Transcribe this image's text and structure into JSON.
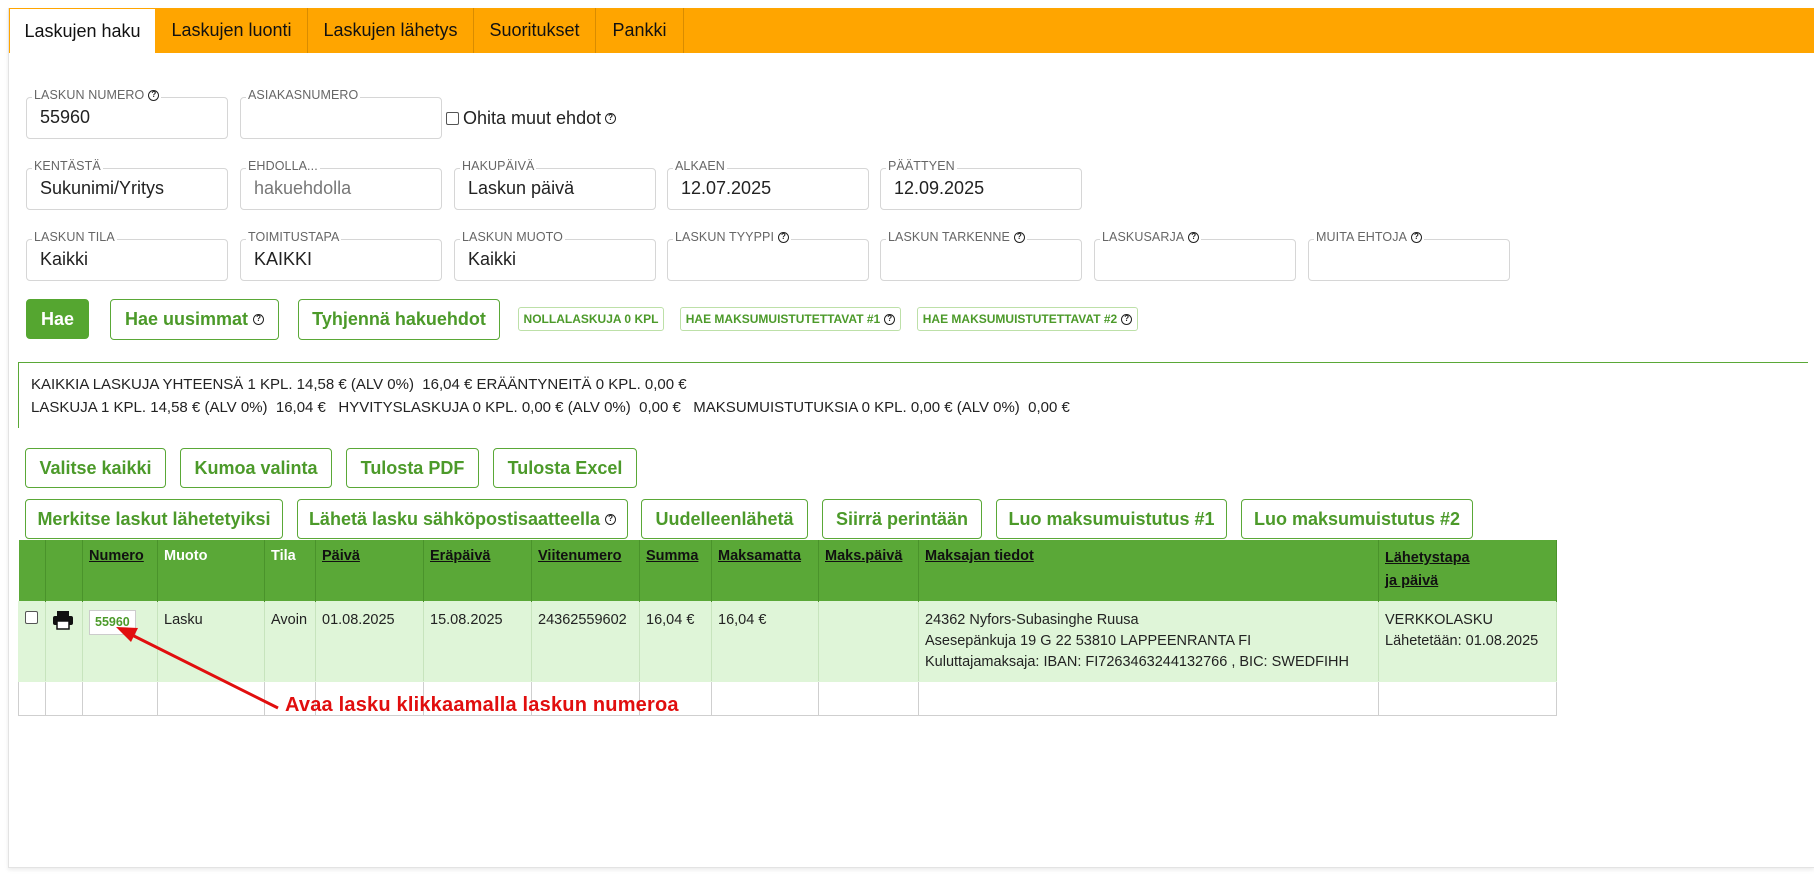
{
  "tabs": [
    "Laskujen haku",
    "Laskujen luonti",
    "Laskujen lähetys",
    "Suoritukset",
    "Pankki"
  ],
  "fields": {
    "laskun_numero": {
      "label": "LASKUN NUMERO",
      "value": "55960"
    },
    "asiakasnumero": {
      "label": "ASIAKASNUMERO",
      "value": ""
    },
    "ohita": {
      "label": "Ohita muut ehdot"
    },
    "kentasta": {
      "label": "KENTÄSTÄ",
      "value": "Sukunimi/Yritys"
    },
    "ehdolla": {
      "label": "EHDOLLA...",
      "placeholder": "hakuehdolla"
    },
    "hakupaiva": {
      "label": "HAKUPÄIVÄ",
      "value": "Laskun päivä"
    },
    "alkaen": {
      "label": "ALKAEN",
      "value": "12.07.2025"
    },
    "paattyen": {
      "label": "PÄÄTTYEN",
      "value": "12.09.2025"
    },
    "laskun_tila": {
      "label": "LASKUN TILA",
      "value": "Kaikki"
    },
    "toimitustapa": {
      "label": "TOIMITUSTAPA",
      "value": "KAIKKI"
    },
    "laskun_muoto": {
      "label": "LASKUN MUOTO",
      "value": "Kaikki"
    },
    "laskun_tyyppi": {
      "label": "LASKUN TYYPPI",
      "value": ""
    },
    "laskun_tarkenne": {
      "label": "LASKUN TARKENNE",
      "value": ""
    },
    "laskusarja": {
      "label": "LASKUSARJA",
      "value": ""
    },
    "muita_ehtoja": {
      "label": "MUITA EHTOJA",
      "value": ""
    }
  },
  "search_buttons": {
    "hae": "Hae",
    "hae_uusimmat": "Hae uusimmat",
    "tyhjenna": "Tyhjennä hakuehdot",
    "nollalaskuja": "NOLLALASKUJA 0 KPL",
    "maksumuistutettavat1": "HAE MAKSUMUISTUTETTAVAT #1",
    "maksumuistutettavat2": "HAE MAKSUMUISTUTETTAVAT #2"
  },
  "summary": {
    "line1": "KAIKKIA LASKUJA YHTEENSÄ 1 KPL. 14,58 € (ALV 0%)  16,04 € ERÄÄNTYNEITÄ 0 KPL. 0,00 €",
    "line2": "LASKUJA 1 KPL. 14,58 € (ALV 0%)  16,04 €   HYVITYSLASKUJA 0 KPL. 0,00 € (ALV 0%)  0,00 €   MAKSUMUISTUTUKSIA 0 KPL. 0,00 € (ALV 0%)  0,00 €"
  },
  "action_buttons": {
    "valitse_kaikki": "Valitse kaikki",
    "kumoa_valinta": "Kumoa valinta",
    "tulosta_pdf": "Tulosta PDF",
    "tulosta_excel": "Tulosta Excel",
    "merkitse": "Merkitse laskut lähetetyiksi",
    "laheta_sahkoposti": "Lähetä lasku sähköpostisaatteella",
    "uudelleenlaheta": "Uudelleenlähetä",
    "siirra_perintaan": "Siirrä perintään",
    "luo_muistutus1": "Luo maksumuistutus #1",
    "luo_muistutus2": "Luo maksumuistutus #2"
  },
  "table": {
    "headers": {
      "numero": "Numero",
      "muoto": "Muoto",
      "tila": "Tila",
      "paiva": "Päivä",
      "erapaiva": "Eräpäivä",
      "viitenumero": "Viitenumero",
      "summa": "Summa",
      "maksamatta": "Maksamatta",
      "maks_paiva": "Maks.päivä",
      "maksajan_tiedot": "Maksajan tiedot",
      "lahetystapa1": "Lähetystapa",
      "lahetystapa2": "ja päivä"
    },
    "row": {
      "numero": "55960",
      "muoto": "Lasku",
      "tila": "Avoin",
      "paiva": "01.08.2025",
      "erapaiva": "15.08.2025",
      "viitenumero": "24362559602",
      "summa": "16,04 €",
      "maksamatta": "16,04 €",
      "maks_paiva": "",
      "maksaja1": "24362 Nyfors-Subasinghe Ruusa",
      "maksaja2": "Asesepänkuja 19 G 22 53810 LAPPEENRANTA FI",
      "maksaja3": "Kuluttajamaksaja: IBAN: FI7263463244132766 , BIC: SWEDFIHH",
      "lahetys1": "VERKKOLASKU",
      "lahetys2": "Lähetetään: 01.08.2025"
    }
  },
  "annotation": "Avaa lasku klikkaamalla laskun numeroa",
  "colors": {
    "tabbar": "#ffa500",
    "green": "#5aa837",
    "row_bg": "#dff5d8",
    "annotation": "#e10e0e"
  }
}
